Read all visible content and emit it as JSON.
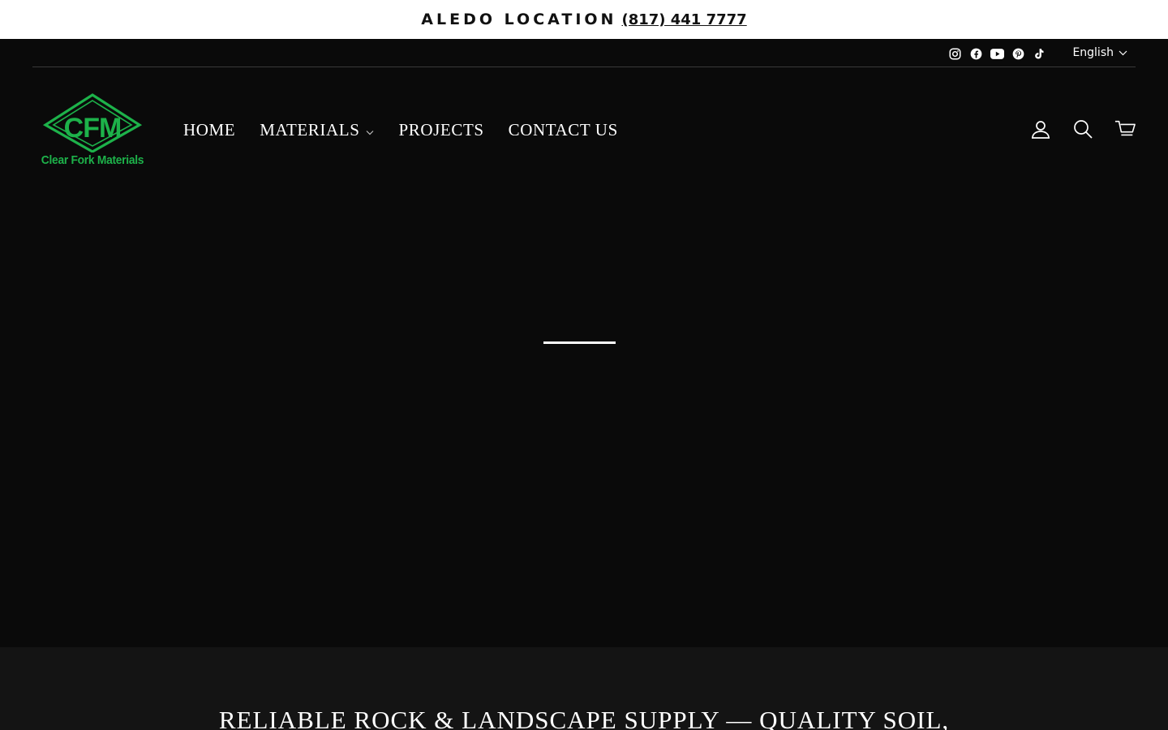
{
  "announcement": {
    "label": "ALEDO LOCATION",
    "phone": "(817) 441 7777"
  },
  "utility": {
    "social": [
      {
        "icon": "instagram-icon"
      },
      {
        "icon": "facebook-icon"
      },
      {
        "icon": "youtube-icon"
      },
      {
        "icon": "pinterest-icon"
      },
      {
        "icon": "tiktok-icon"
      }
    ],
    "language": "English"
  },
  "logo": {
    "monogram": "CFM",
    "name": "Clear Fork Materials",
    "color": "#1db24a"
  },
  "nav": {
    "home": "HOME",
    "materials": "MATERIALS",
    "projects": "PROJECTS",
    "contact": "CONTACT US"
  },
  "tools": {
    "account_icon": "account-icon",
    "search_icon": "search-icon",
    "cart_icon": "cart-icon"
  },
  "intro": {
    "heading": "RELIABLE ROCK & LANDSCAPE SUPPLY — QUALITY SOIL,"
  }
}
